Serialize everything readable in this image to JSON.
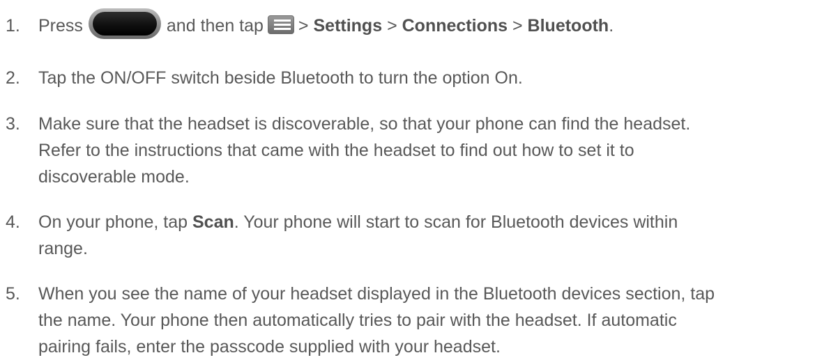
{
  "steps": [
    {
      "number": "1.",
      "press": "Press",
      "and_then_tap": "and then tap",
      "sep1": ">",
      "settings": "Settings",
      "sep2": ">",
      "connections": "Connections",
      "sep3": ">",
      "bluetooth": "Bluetooth",
      "end": ".",
      "home_icon": "home-button-icon",
      "menu_icon": "menu-key-icon"
    },
    {
      "number": "2.",
      "line1": "Tap the ON/OFF switch beside Bluetooth to turn the option On."
    },
    {
      "number": "3.",
      "line1": "Make sure that the headset is discoverable, so that your phone can find the headset.",
      "line2": "Refer to the instructions that came with the headset to find out how to set it to",
      "line3": "discoverable mode."
    },
    {
      "number": "4.",
      "pre": "On your phone, tap",
      "scan": "Scan",
      "post": ". Your phone will start to scan for Bluetooth devices within",
      "line2": "range."
    },
    {
      "number": "5.",
      "line1": "When you see the name of your headset displayed in the Bluetooth devices section, tap",
      "line2": "the name. Your phone then automatically tries to pair with the headset. If automatic",
      "line3": "pairing fails, enter the passcode supplied with your headset."
    }
  ]
}
